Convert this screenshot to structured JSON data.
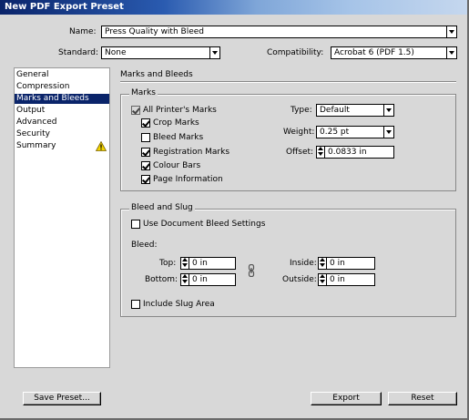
{
  "window": {
    "title": "New PDF Export Preset"
  },
  "preset": {
    "name_label": "Name:",
    "name_value": "Press Quality with Bleed",
    "standard_label": "Standard:",
    "standard_value": "None",
    "compatibility_label": "Compatibility:",
    "compatibility_value": "Acrobat 6 (PDF 1.5)"
  },
  "sidebar": {
    "items": [
      {
        "label": "General"
      },
      {
        "label": "Compression"
      },
      {
        "label": "Marks and Bleeds",
        "selected": true
      },
      {
        "label": "Output"
      },
      {
        "label": "Advanced"
      },
      {
        "label": "Security"
      },
      {
        "label": "Summary",
        "warning": true
      }
    ]
  },
  "panel": {
    "title": "Marks and Bleeds",
    "marks": {
      "group_label": "Marks",
      "all_printers_marks": {
        "label": "All Printer's Marks",
        "checked": true
      },
      "crop_marks": {
        "label": "Crop Marks",
        "checked": true
      },
      "bleed_marks": {
        "label": "Bleed Marks",
        "checked": false
      },
      "registration_marks": {
        "label": "Registration Marks",
        "checked": true
      },
      "colour_bars": {
        "label": "Colour Bars",
        "checked": true
      },
      "page_information": {
        "label": "Page Information",
        "checked": true
      },
      "type_label": "Type:",
      "type_value": "Default",
      "weight_label": "Weight:",
      "weight_value": "0.25 pt",
      "offset_label": "Offset:",
      "offset_value": "0.0833 in"
    },
    "bleed": {
      "group_label": "Bleed and Slug",
      "use_document_bleed": {
        "label": "Use Document Bleed Settings",
        "checked": false
      },
      "bleed_label": "Bleed:",
      "top_label": "Top:",
      "top_value": "0 in",
      "bottom_label": "Bottom:",
      "bottom_value": "0 in",
      "inside_label": "Inside:",
      "inside_value": "0 in",
      "outside_label": "Outside:",
      "outside_value": "0 in",
      "include_slug": {
        "label": "Include Slug Area",
        "checked": false
      }
    }
  },
  "buttons": {
    "save_preset": "Save Preset...",
    "export": "Export",
    "reset": "Reset"
  }
}
